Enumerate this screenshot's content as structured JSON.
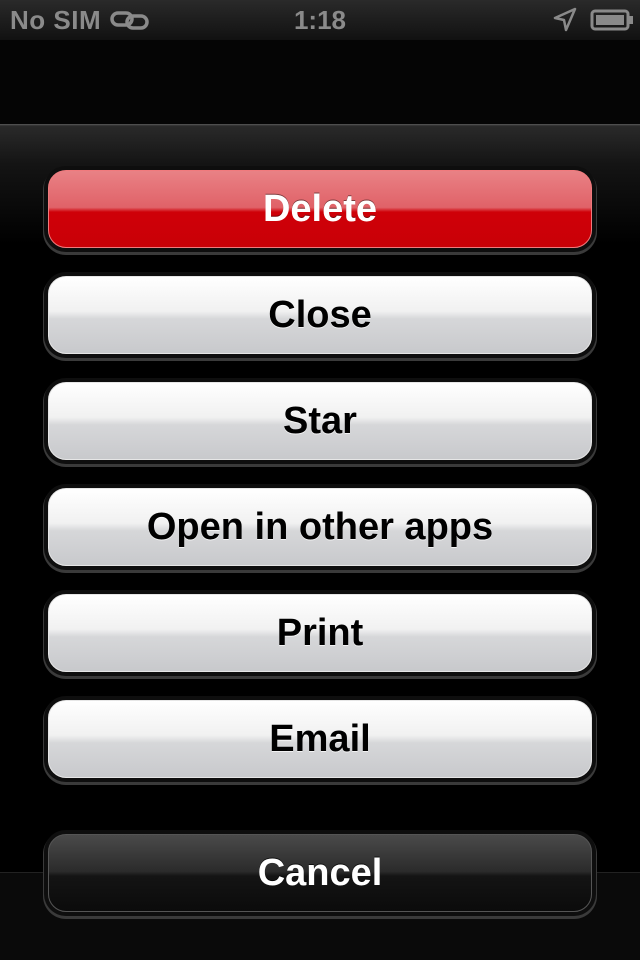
{
  "status_bar": {
    "carrier": "No SIM",
    "time": "1:18",
    "icons": [
      "link-icon",
      "location-arrow-icon",
      "battery-icon"
    ]
  },
  "action_sheet": {
    "buttons": [
      {
        "label": "Delete",
        "style": "destructive",
        "color": "#cc0000"
      },
      {
        "label": "Close",
        "style": "default"
      },
      {
        "label": "Star",
        "style": "default"
      },
      {
        "label": "Open in other apps",
        "style": "default"
      },
      {
        "label": "Print",
        "style": "default"
      },
      {
        "label": "Email",
        "style": "default"
      }
    ],
    "cancel_label": "Cancel"
  }
}
